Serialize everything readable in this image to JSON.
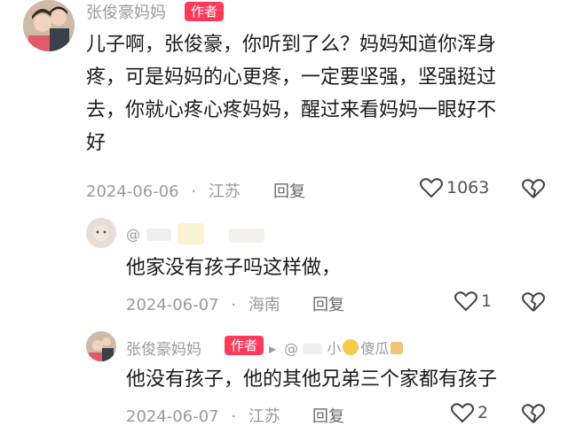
{
  "main_comment": {
    "username": "张俊豪妈妈",
    "author_tag": "作者",
    "text_lines": [
      "儿子啊，张俊豪，你听到了么？妈妈知道你浑身",
      "疼，可是妈妈的心更疼，一定要坚强，坚强挺过",
      "去，你就心疼心疼妈妈，醒过来看妈妈一眼好不",
      "好"
    ],
    "date": "2024-06-06",
    "location": "江苏",
    "reply_label": "回复",
    "likes": "1063"
  },
  "reply1": {
    "username": "@",
    "text": "他家没有孩子吗这样做，",
    "date": "2024-06-07",
    "location": "海南",
    "reply_label": "回复",
    "likes": "1"
  },
  "reply2": {
    "username": "张俊豪妈妈",
    "author_tag": "作者",
    "arrow": "▸",
    "target_prefix": "@",
    "target_name_a": "小",
    "target_name_b": "傻瓜",
    "text": "他没有孩子，他的其他兄弟三个家都有孩子",
    "date": "2024-06-07",
    "location": "江苏",
    "reply_label": "回复",
    "likes": "2"
  },
  "separator": "·",
  "colors": {
    "tag": "#ff3b5c",
    "meta": "#9a9a9a",
    "text": "#1a1a1a"
  }
}
